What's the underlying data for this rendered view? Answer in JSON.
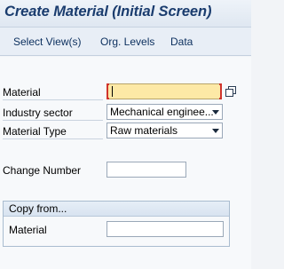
{
  "window": {
    "title": "Create Material (Initial Screen)"
  },
  "menu": {
    "items": [
      {
        "label": "Select View(s)"
      },
      {
        "label": "Org. Levels"
      },
      {
        "label": "Data"
      }
    ]
  },
  "form": {
    "material": {
      "label": "Material",
      "value": "",
      "required": true
    },
    "industry_sector": {
      "label": "Industry sector",
      "value": "Mechanical enginee..."
    },
    "material_type": {
      "label": "Material Type",
      "value": "Raw materials"
    },
    "change_number": {
      "label": "Change Number",
      "value": ""
    }
  },
  "copy_from": {
    "title": "Copy from...",
    "material": {
      "label": "Material",
      "value": ""
    }
  },
  "icons": {
    "value_help": "value-help-icon",
    "dropdown": "chevron-down-icon"
  },
  "colors": {
    "title_text": "#1a3c6e",
    "menu_text": "#0b2f5e",
    "required_field_bg": "#fde9a6",
    "required_marker": "#d0342c",
    "background": "#f7f9fb"
  }
}
